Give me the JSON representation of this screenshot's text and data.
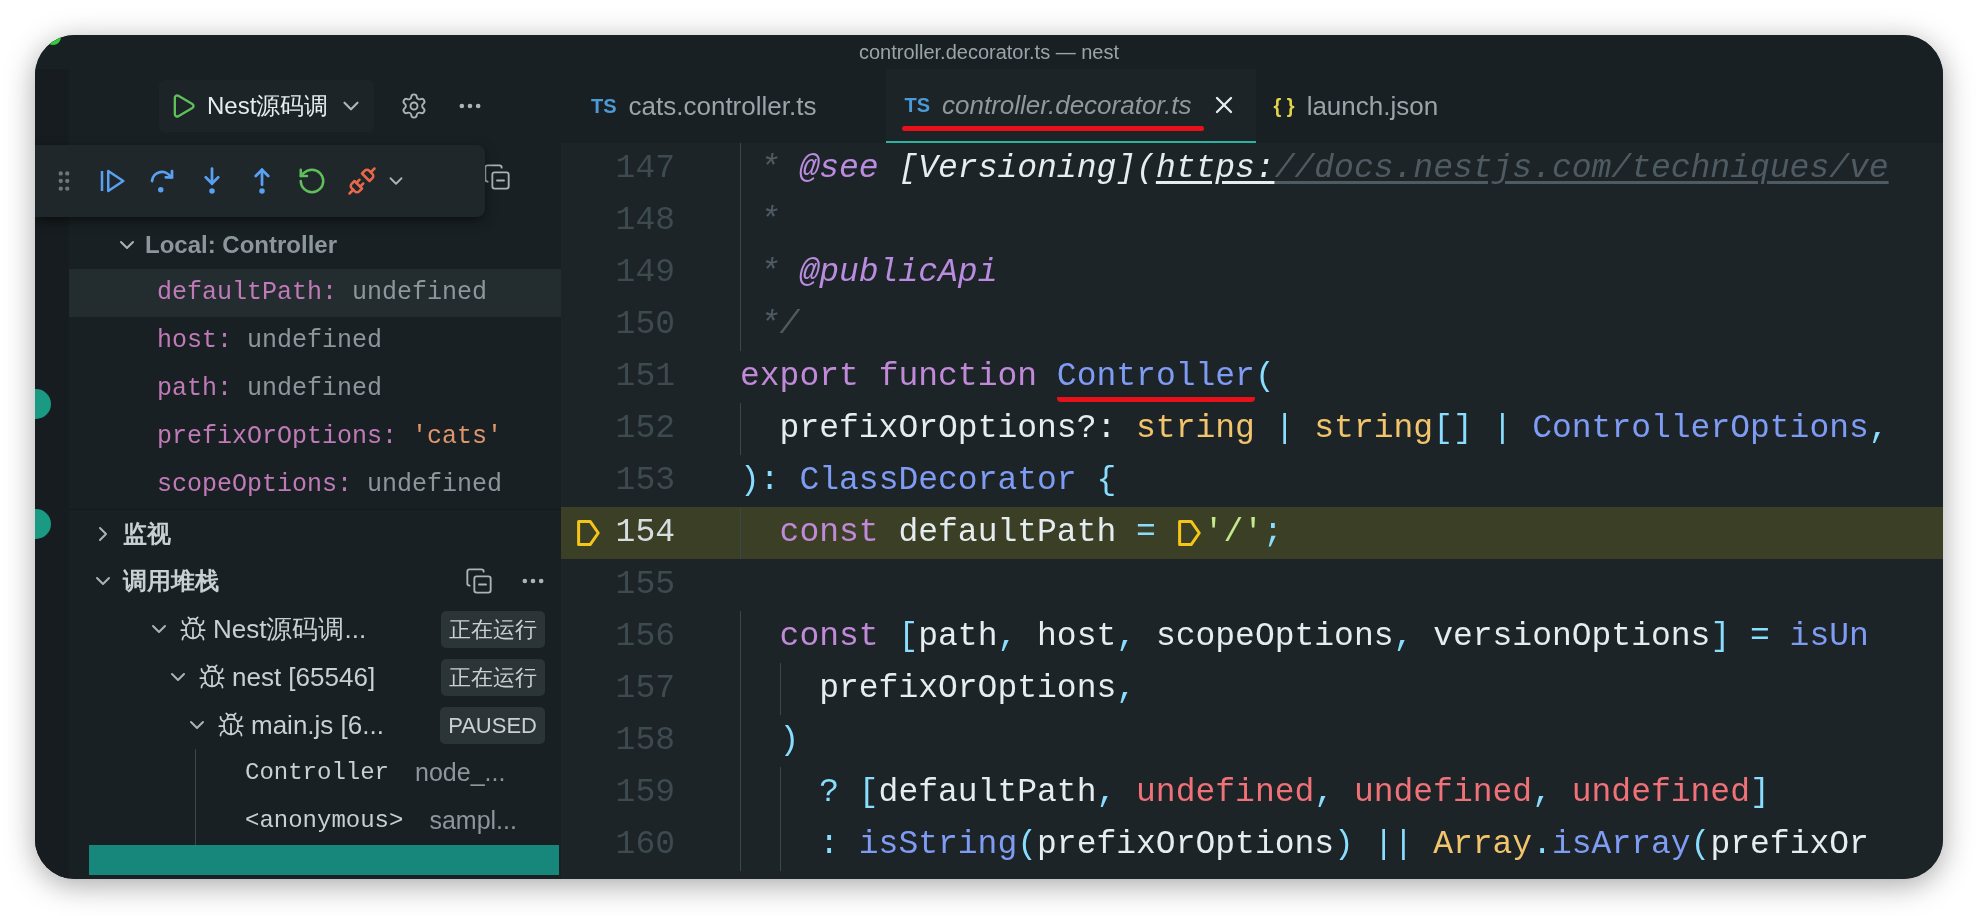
{
  "window": {
    "title": "controller.decorator.ts — nest"
  },
  "sidebar": {
    "run_config": {
      "label": "Nest源码调"
    },
    "variables": {
      "scope": {
        "label": "Local: Controller",
        "expanded": true,
        "children": [
          {
            "name": "defaultPath:",
            "value": "undefined",
            "kind": "undefined",
            "selected": true
          },
          {
            "name": "host:",
            "value": "undefined",
            "kind": "undefined",
            "selected": false
          },
          {
            "name": "path:",
            "value": "undefined",
            "kind": "undefined",
            "selected": false
          },
          {
            "name": "prefixOrOptions:",
            "value": "'cats'",
            "kind": "string",
            "selected": false
          },
          {
            "name": "scopeOptions:",
            "value": "undefined",
            "kind": "undefined",
            "selected": false
          }
        ]
      }
    },
    "watch": {
      "label": "监视",
      "expanded": false
    },
    "call_stack": {
      "label": "调用堆栈",
      "expanded": true,
      "sessions": [
        {
          "label": "Nest源码调...",
          "status": "正在运行",
          "expanded": true,
          "children": [
            {
              "label": "nest [65546]",
              "status": "正在运行",
              "expanded": true,
              "children": [
                {
                  "label": "main.js [6...",
                  "status": "PAUSED",
                  "expanded": true,
                  "frames": [
                    {
                      "function": "Controller",
                      "file": "node_..."
                    },
                    {
                      "function": "<anonymous>",
                      "file": "sampl..."
                    }
                  ]
                }
              ]
            }
          ]
        }
      ]
    }
  },
  "tabs": [
    {
      "icon": "TS",
      "label": "cats.controller.ts",
      "selected": false,
      "annotated": false
    },
    {
      "icon": "TS",
      "label": "controller.decorator.ts",
      "selected": true,
      "annotated": true
    },
    {
      "icon": "{ }",
      "label": "launch.json",
      "selected": false,
      "annotated": false
    }
  ],
  "editor": {
    "lines": [
      {
        "number": "147",
        "current": false,
        "tokens": [
          {
            "text": " * ",
            "kind": "comment"
          },
          {
            "text": "@see",
            "kind": "doctag"
          },
          {
            "text": " [Versioning](",
            "kind": "doctext"
          },
          {
            "text": "https:",
            "kind": "link"
          },
          {
            "text": "//docs.nestjs.com/techniques/ve",
            "kind": "linkfaded"
          }
        ]
      },
      {
        "number": "148",
        "current": false,
        "tokens": [
          {
            "text": " *",
            "kind": "comment"
          }
        ]
      },
      {
        "number": "149",
        "current": false,
        "tokens": [
          {
            "text": " * ",
            "kind": "comment"
          },
          {
            "text": "@publicApi",
            "kind": "doctag"
          }
        ]
      },
      {
        "number": "150",
        "current": false,
        "tokens": [
          {
            "text": " */",
            "kind": "comment"
          }
        ]
      },
      {
        "number": "151",
        "current": false,
        "tokens": [
          {
            "text": "export ",
            "kind": "keyword"
          },
          {
            "text": "function ",
            "kind": "keyword"
          },
          {
            "text": "Controller",
            "kind": "function",
            "annotated": true
          },
          {
            "text": "(",
            "kind": "punct"
          }
        ]
      },
      {
        "number": "152",
        "current": false,
        "tokens": [
          {
            "text": "  prefixOrOptions?: ",
            "kind": "plain"
          },
          {
            "text": "string",
            "kind": "type"
          },
          {
            "text": " | ",
            "kind": "punct"
          },
          {
            "text": "string",
            "kind": "type"
          },
          {
            "text": "[] | ",
            "kind": "punct"
          },
          {
            "text": "ControllerOptions",
            "kind": "function"
          },
          {
            "text": ",",
            "kind": "punct"
          }
        ]
      },
      {
        "number": "153",
        "current": false,
        "tokens": [
          {
            "text": "): ",
            "kind": "punct"
          },
          {
            "text": "ClassDecorator",
            "kind": "function"
          },
          {
            "text": " {",
            "kind": "punct"
          }
        ]
      },
      {
        "number": "154",
        "current": true,
        "tokens": [
          {
            "text": "  const",
            "kind": "keyword"
          },
          {
            "text": " defaultPath ",
            "kind": "plain"
          },
          {
            "text": "= ",
            "kind": "punct"
          },
          {
            "kind": "breakpoint"
          },
          {
            "text": "'/'",
            "kind": "string"
          },
          {
            "text": ";",
            "kind": "punct"
          }
        ]
      },
      {
        "number": "155",
        "current": false
      },
      {
        "number": "156",
        "current": false,
        "tokens": [
          {
            "text": "  const",
            "kind": "keyword"
          },
          {
            "text": " [",
            "kind": "punct"
          },
          {
            "text": "path",
            "kind": "plain"
          },
          {
            "text": ", ",
            "kind": "punct"
          },
          {
            "text": "host",
            "kind": "plain"
          },
          {
            "text": ", ",
            "kind": "punct"
          },
          {
            "text": "scopeOptions",
            "kind": "plain"
          },
          {
            "text": ", ",
            "kind": "punct"
          },
          {
            "text": "versionOptions",
            "kind": "plain"
          },
          {
            "text": "] = ",
            "kind": "punct"
          },
          {
            "text": "isUn",
            "kind": "function"
          }
        ]
      },
      {
        "number": "157",
        "current": false,
        "tokens": [
          {
            "text": "    prefixOrOptions",
            "kind": "plain"
          },
          {
            "text": ",",
            "kind": "punct"
          }
        ]
      },
      {
        "number": "158",
        "current": false,
        "tokens": [
          {
            "text": "  )",
            "kind": "punct"
          }
        ]
      },
      {
        "number": "159",
        "current": false,
        "tokens": [
          {
            "text": "    ? [",
            "kind": "punct"
          },
          {
            "text": "defaultPath",
            "kind": "plain"
          },
          {
            "text": ", ",
            "kind": "punct"
          },
          {
            "text": "undefined",
            "kind": "red"
          },
          {
            "text": ", ",
            "kind": "punct"
          },
          {
            "text": "undefined",
            "kind": "red"
          },
          {
            "text": ", ",
            "kind": "punct"
          },
          {
            "text": "undefined",
            "kind": "red"
          },
          {
            "text": "]",
            "kind": "punct"
          }
        ]
      },
      {
        "number": "160",
        "current": false,
        "tokens": [
          {
            "text": "    : ",
            "kind": "punct"
          },
          {
            "text": "isString",
            "kind": "function"
          },
          {
            "text": "(",
            "kind": "punct"
          },
          {
            "text": "prefixOrOptions",
            "kind": "plain"
          },
          {
            "text": ") || ",
            "kind": "punct"
          },
          {
            "text": "Array",
            "kind": "type"
          },
          {
            "text": ".",
            "kind": "punct"
          },
          {
            "text": "isArray",
            "kind": "function"
          },
          {
            "text": "(",
            "kind": "punct"
          },
          {
            "text": "prefixOr",
            "kind": "plain"
          }
        ]
      }
    ]
  }
}
